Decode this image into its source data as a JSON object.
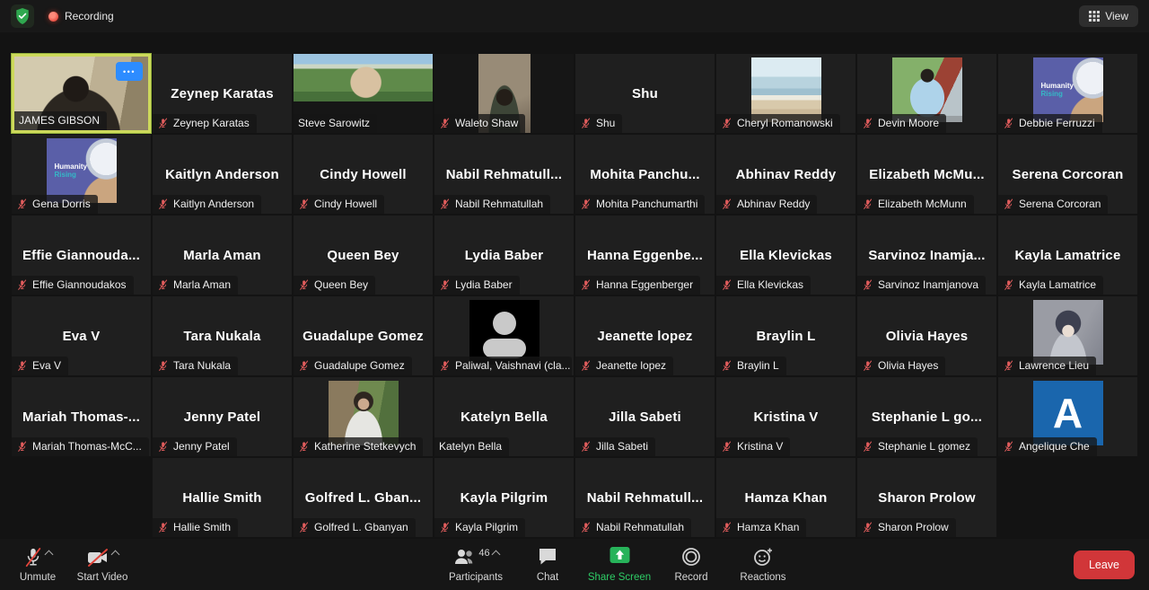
{
  "topbar": {
    "recording_label": "Recording",
    "view_label": "View"
  },
  "toolbar": {
    "unmute_label": "Unmute",
    "start_video_label": "Start Video",
    "participants_label": "Participants",
    "participants_count": "46",
    "chat_label": "Chat",
    "share_screen_label": "Share Screen",
    "record_label": "Record",
    "reactions_label": "Reactions",
    "leave_label": "Leave"
  },
  "colors": {
    "accent_blue": "#2d8cff",
    "active_speaker_border": "#cdd95b",
    "muted_mic_red": "#e05c5c",
    "share_screen_green": "#27b35a",
    "leave_red": "#d13639",
    "recording_red": "#d5271d",
    "shield_green": "#2fa84f"
  },
  "rows": [
    [
      {
        "type": "video",
        "variant": "james",
        "label": "JAMES GIBSON",
        "muted": false,
        "active": true,
        "more": true
      },
      {
        "type": "text",
        "name": "Zeynep Karatas",
        "label": "Zeynep Karatas",
        "muted": true
      },
      {
        "type": "video",
        "variant": "steve",
        "label": "Steve Sarowitz",
        "muted": false
      },
      {
        "type": "video",
        "variant": "waleto",
        "label": "Waleto Shaw",
        "muted": true
      },
      {
        "type": "text",
        "name": "Shu",
        "label": "Shu",
        "muted": true
      },
      {
        "type": "image",
        "variant": "beach",
        "label": "Cheryl Romanowski",
        "muted": true
      },
      {
        "type": "image",
        "variant": "devin",
        "label": "Devin Moore",
        "muted": true
      },
      {
        "type": "image",
        "variant": "humanity",
        "label": "Debbie Ferruzzi",
        "muted": true,
        "logo_text": "Humanity Rising"
      }
    ],
    [
      {
        "type": "image",
        "variant": "humanity",
        "label": "Gena Dorris",
        "muted": true,
        "logo_text": "Humanity Rising"
      },
      {
        "type": "text",
        "name": "Kaitlyn Anderson",
        "label": "Kaitlyn Anderson",
        "muted": true
      },
      {
        "type": "text",
        "name": "Cindy Howell",
        "label": "Cindy Howell",
        "muted": true
      },
      {
        "type": "text",
        "name": "Nabil Rehmatull...",
        "label": "Nabil Rehmatullah",
        "muted": true
      },
      {
        "type": "text",
        "name": "Mohita Panchu...",
        "label": "Mohita Panchumarthi",
        "muted": true
      },
      {
        "type": "text",
        "name": "Abhinav Reddy",
        "label": "Abhinav Reddy",
        "muted": true
      },
      {
        "type": "text",
        "name": "Elizabeth McMu...",
        "label": "Elizabeth McMunn",
        "muted": true
      },
      {
        "type": "text",
        "name": "Serena Corcoran",
        "label": "Serena Corcoran",
        "muted": true
      }
    ],
    [
      {
        "type": "text",
        "name": "Effie Giannouda...",
        "label": "Effie Giannoudakos",
        "muted": true
      },
      {
        "type": "text",
        "name": "Marla Aman",
        "label": "Marla Aman",
        "muted": true
      },
      {
        "type": "text",
        "name": "Queen Bey",
        "label": "Queen Bey",
        "muted": true
      },
      {
        "type": "text",
        "name": "Lydia Baber",
        "label": "Lydia Baber",
        "muted": true
      },
      {
        "type": "text",
        "name": "Hanna Eggenbe...",
        "label": "Hanna Eggenberger",
        "muted": true
      },
      {
        "type": "text",
        "name": "Ella Klevickas",
        "label": "Ella Klevickas",
        "muted": true
      },
      {
        "type": "text",
        "name": "Sarvinoz Inamja...",
        "label": "Sarvinoz Inamjanova",
        "muted": true
      },
      {
        "type": "text",
        "name": "Kayla Lamatrice",
        "label": "Kayla Lamatrice",
        "muted": true
      }
    ],
    [
      {
        "type": "text",
        "name": "Eva V",
        "label": "Eva V",
        "muted": true
      },
      {
        "type": "text",
        "name": "Tara Nukala",
        "label": "Tara Nukala",
        "muted": true
      },
      {
        "type": "text",
        "name": "Guadalupe Gomez",
        "label": "Guadalupe Gomez",
        "muted": true
      },
      {
        "type": "image",
        "variant": "avatar",
        "label": "Paliwal, Vaishnavi (cla...",
        "muted": true
      },
      {
        "type": "text",
        "name": "Jeanette lopez",
        "label": "Jeanette lopez",
        "muted": true
      },
      {
        "type": "text",
        "name": "Braylin L",
        "label": "Braylin L",
        "muted": true
      },
      {
        "type": "text",
        "name": "Olivia Hayes",
        "label": "Olivia Hayes",
        "muted": true
      },
      {
        "type": "image",
        "variant": "anime",
        "label": "Lawrence Lieu",
        "muted": true
      }
    ],
    [
      {
        "type": "text",
        "name": "Mariah Thomas-...",
        "label": "Mariah Thomas-McC...",
        "muted": true
      },
      {
        "type": "text",
        "name": "Jenny Patel",
        "label": "Jenny Patel",
        "muted": true
      },
      {
        "type": "image",
        "variant": "katherine",
        "label": "Katherine Stetkevych",
        "muted": true
      },
      {
        "type": "text",
        "name": "Katelyn Bella",
        "label": "Katelyn Bella",
        "muted": false
      },
      {
        "type": "text",
        "name": "Jilla Sabeti",
        "label": "Jilla Sabeti",
        "muted": true
      },
      {
        "type": "text",
        "name": "Kristina V",
        "label": "Kristina V",
        "muted": true
      },
      {
        "type": "text",
        "name": "Stephanie L go...",
        "label": "Stephanie L gomez",
        "muted": true
      },
      {
        "type": "image",
        "variant": "letterA",
        "label": "Angelique Che",
        "muted": true,
        "letter": "A"
      }
    ],
    [
      {
        "type": "text",
        "name": "Hallie Smith",
        "label": "Hallie Smith",
        "muted": true
      },
      {
        "type": "text",
        "name": "Golfred L. Gban...",
        "label": "Golfred L. Gbanyan",
        "muted": true
      },
      {
        "type": "text",
        "name": "Kayla Pilgrim",
        "label": "Kayla Pilgrim",
        "muted": true
      },
      {
        "type": "text",
        "name": "Nabil Rehmatull...",
        "label": "Nabil Rehmatullah",
        "muted": true
      },
      {
        "type": "text",
        "name": "Hamza Khan",
        "label": "Hamza Khan",
        "muted": true
      },
      {
        "type": "text",
        "name": "Sharon Prolow",
        "label": "Sharon Prolow",
        "muted": true
      }
    ]
  ]
}
